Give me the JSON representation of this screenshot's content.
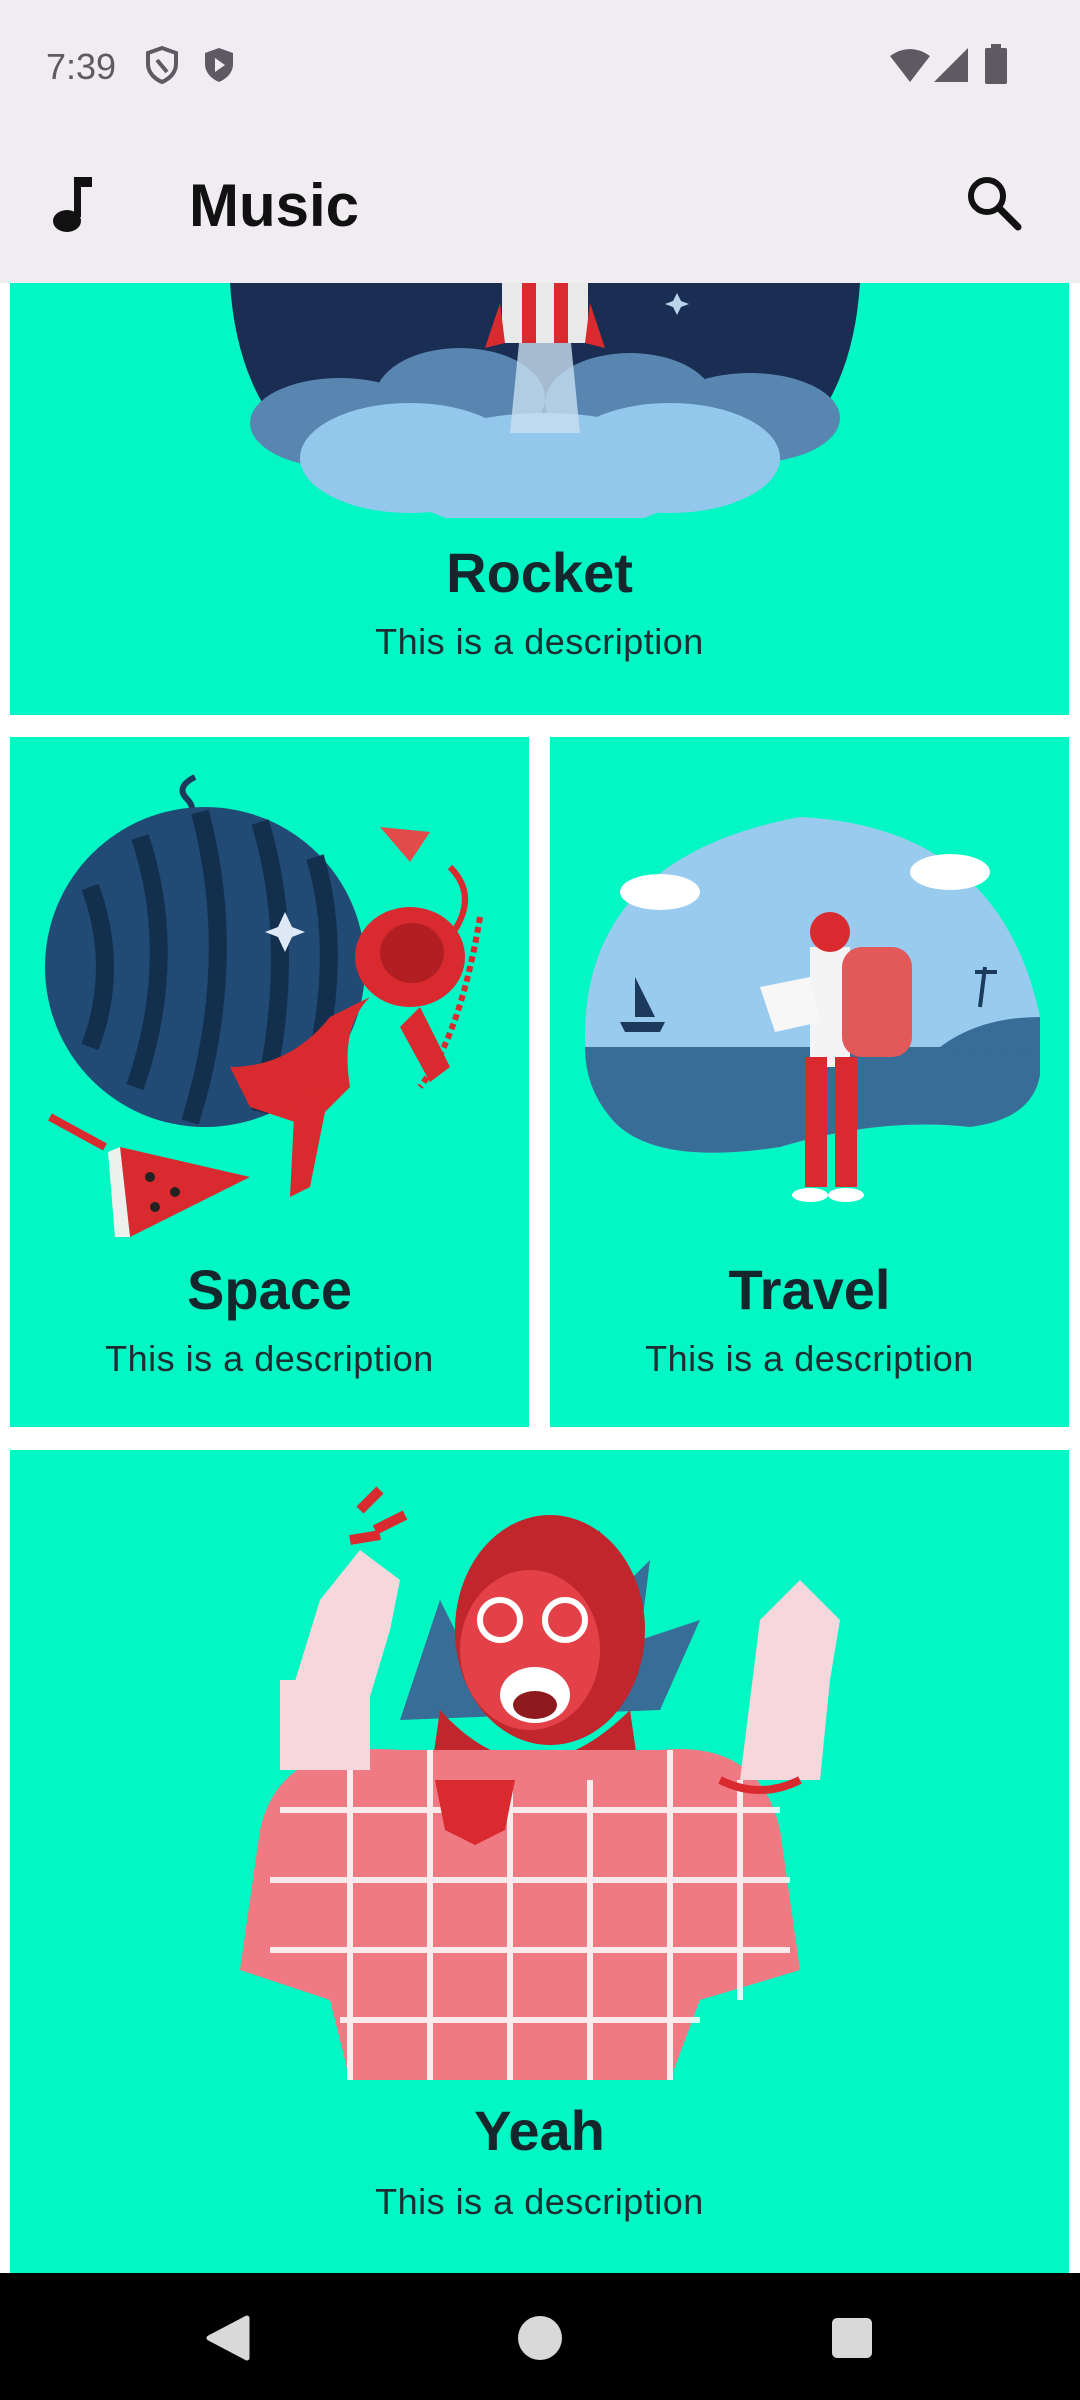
{
  "status_bar": {
    "time": "7:39",
    "left_icons": [
      "shield-outline-icon",
      "play-shield-icon"
    ],
    "right_icons": [
      "wifi-icon",
      "cell-signal-icon",
      "battery-icon"
    ]
  },
  "app_bar": {
    "title": "Music",
    "leading_icon": "music-note-icon",
    "action_icon": "search-icon"
  },
  "cards": [
    {
      "title": "Rocket",
      "description": "This is a description",
      "illustration": "rocket-launch"
    },
    {
      "title": "Space",
      "description": "This is a description",
      "illustration": "astronaut-watermelon"
    },
    {
      "title": "Travel",
      "description": "This is a description",
      "illustration": "backpacker-map"
    },
    {
      "title": "Yeah",
      "description": "This is a description",
      "illustration": "cheering-man"
    }
  ],
  "colors": {
    "card_background": "#02f7c4",
    "app_bar_background": "#f1ecf2",
    "illustration_red": "#d92b2f",
    "illustration_navy": "#1b3a5c"
  },
  "nav_bar": {
    "buttons": [
      "back-icon",
      "home-icon",
      "recents-icon"
    ]
  }
}
